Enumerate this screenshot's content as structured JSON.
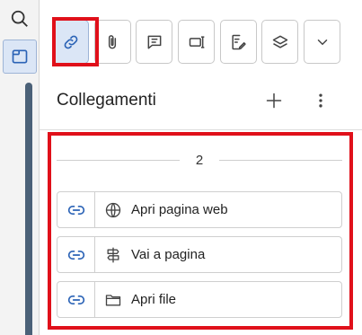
{
  "left_toolbar": {
    "items": [
      {
        "name": "search",
        "icon": "search-icon"
      },
      {
        "name": "panel",
        "icon": "sidebar-panel-icon",
        "active": true
      }
    ]
  },
  "toolbar": {
    "items": [
      {
        "name": "links",
        "icon": "link-icon",
        "active": true
      },
      {
        "name": "attachments",
        "icon": "paperclip-icon"
      },
      {
        "name": "comments",
        "icon": "comment-icon"
      },
      {
        "name": "form-field",
        "icon": "form-field-icon"
      },
      {
        "name": "signature",
        "icon": "signature-icon"
      },
      {
        "name": "layers",
        "icon": "layers-icon"
      },
      {
        "name": "more",
        "icon": "chevron-down-icon"
      }
    ]
  },
  "panel": {
    "title": "Collegamenti",
    "group": {
      "count": "2"
    },
    "items": [
      {
        "label": "Apri pagina web",
        "type_icon": "globe-icon"
      },
      {
        "label": "Vai a pagina",
        "type_icon": "signpost-icon"
      },
      {
        "label": "Apri file",
        "type_icon": "folder-icon"
      }
    ]
  },
  "colors": {
    "highlight": "#e0101a",
    "active_bg": "#dbe6f6",
    "accent": "#2b63b6"
  }
}
